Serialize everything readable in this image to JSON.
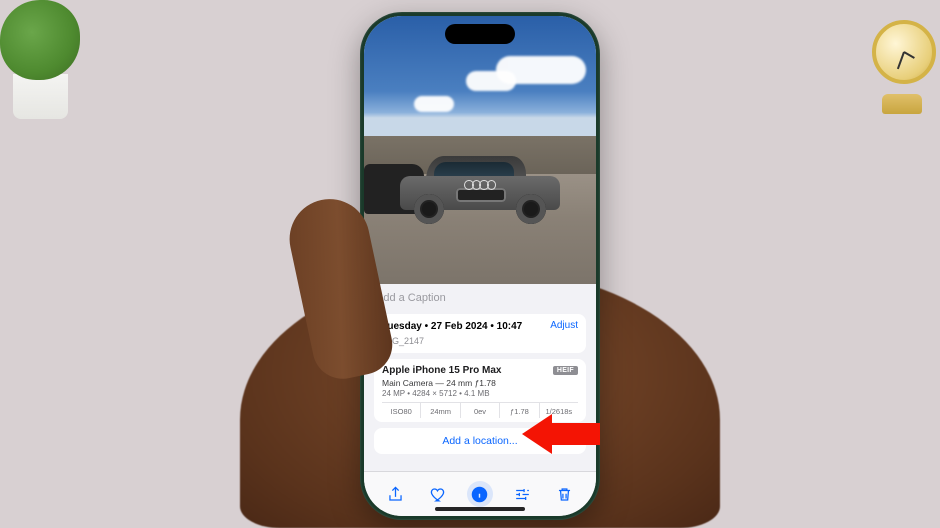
{
  "caption_placeholder": "Add a Caption",
  "datetime": "Tuesday • 27 Feb 2024 • 10:47",
  "filename": "IMG_2147",
  "adjust_label": "Adjust",
  "device": "Apple iPhone 15 Pro Max",
  "format_badge": "HEIF",
  "camera_line": "Main Camera — 24 mm ƒ1.78",
  "spec_line": "24 MP • 4284 × 5712 • 4.1 MB",
  "exif": {
    "iso": "ISO80",
    "focal": "24mm",
    "ev": "0ev",
    "aperture": "ƒ1.78",
    "shutter": "1/2618s"
  },
  "add_location_label": "Add a location...",
  "toolbar": {
    "share": "Share",
    "favorite": "Favorite",
    "info": "Info",
    "edit": "Edit",
    "delete": "Delete"
  }
}
